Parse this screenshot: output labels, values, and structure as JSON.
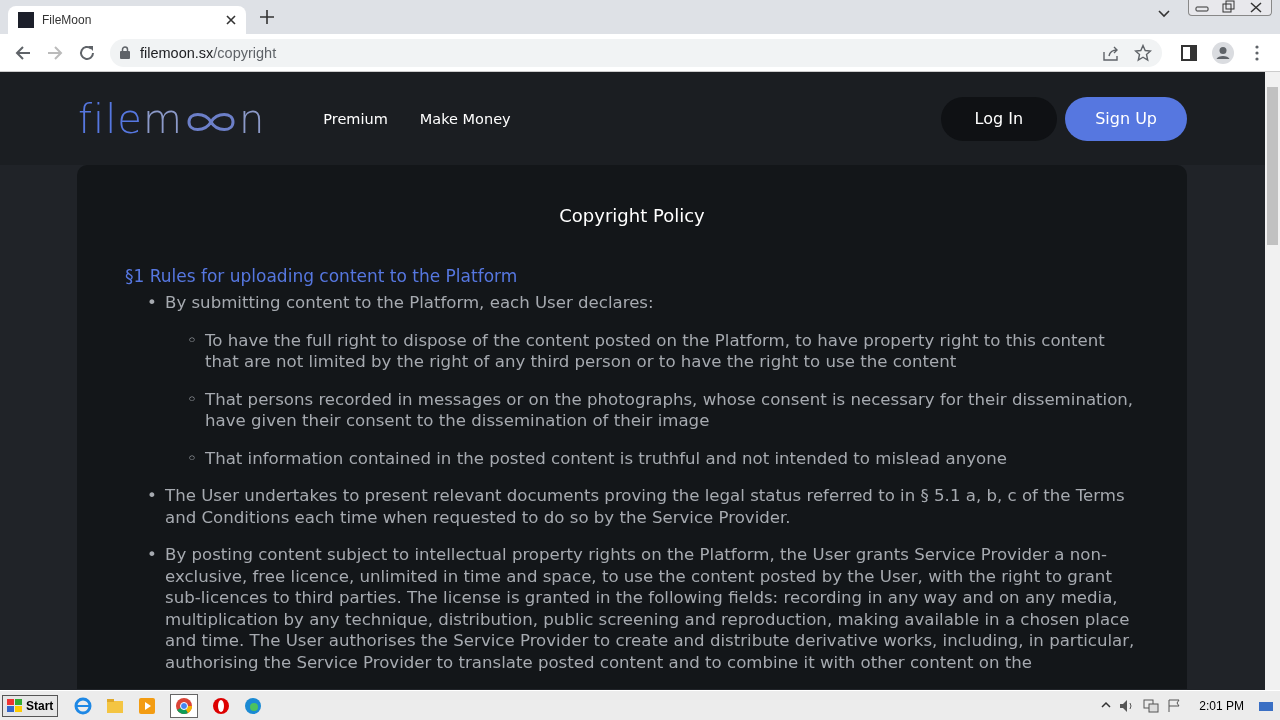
{
  "browser": {
    "tab": {
      "title": "FileMoon",
      "selected": true
    },
    "url_host": "filemoon.sx",
    "url_path": "/copyright"
  },
  "site": {
    "logo": {
      "head": "file",
      "mid": "m",
      "tail": "n"
    },
    "nav": [
      "Premium",
      "Make Money"
    ],
    "buttons": [
      {
        "label": "Log In",
        "kind": "secondary"
      },
      {
        "label": "Sign Up",
        "kind": "primary"
      }
    ]
  },
  "policy": {
    "title": "Copyright Policy",
    "sections": [
      {
        "heading": "§1 Rules for uploading content to the Platform",
        "items": [
          {
            "marker": "•",
            "text": "By submitting content to the Platform, each User declares:",
            "children": [
              {
                "marker": "◦",
                "text": "To have the full right to dispose of the content posted on the Platform, to have property right to this content that are not limited by the right of any third person or to have the right to use the content"
              },
              {
                "marker": "◦",
                "text": "That persons recorded in messages or on the photographs, whose consent is necessary for their dissemination, have given their consent to the dissemination of their image"
              },
              {
                "marker": "◦",
                "text": "That information contained in the posted content is truthful and not intended to mislead anyone"
              }
            ]
          },
          {
            "marker": "•",
            "text": "The User undertakes to present relevant documents proving the legal status referred to in § 5.1 a, b, c of the Terms and Conditions each time when requested to do so by the Service Provider."
          },
          {
            "marker": "•",
            "text": "By posting content subject to intellectual property rights on the Platform, the User grants Service Provider a non-exclusive, free licence, unlimited in time and space, to use the content posted by the User, with the right to grant sub-licences to third parties. The license is granted in the following fields: recording in any way and on any media, multiplication by any technique, distribution, public screening and reproduction, making available in a chosen place and time. The User authorises the Service Provider to create and distribute derivative works, including, in particular, authorising the Service Provider to translate posted content and to combine it with other content on the"
          }
        ]
      }
    ]
  },
  "taskbar": {
    "start": "Start",
    "time": "2:01 PM"
  }
}
